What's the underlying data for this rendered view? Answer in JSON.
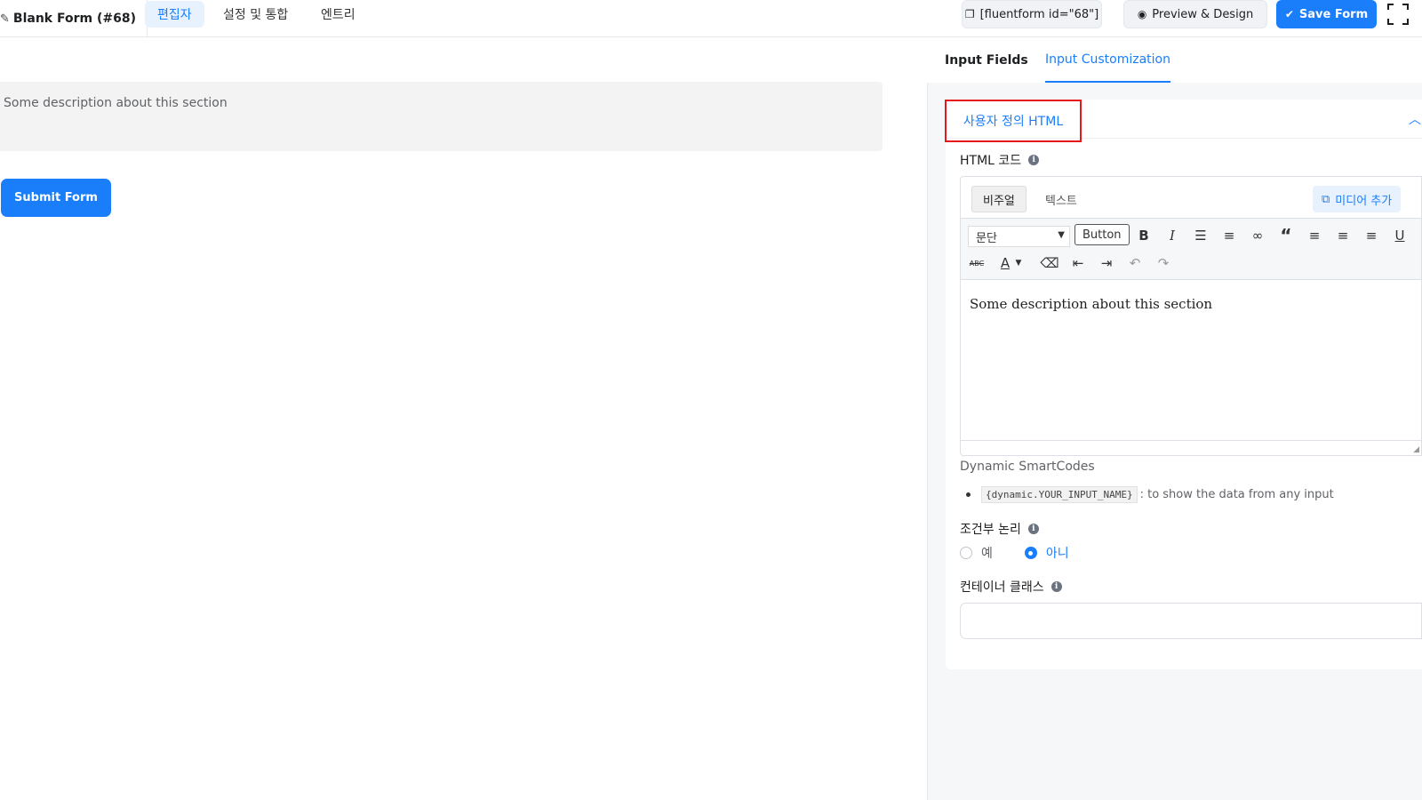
{
  "topbar": {
    "form_title": "Blank Form (#68)",
    "tabs": [
      "편집자",
      "설정 및 통합",
      "엔트리"
    ],
    "shortcode": "[fluentform id=\"68\"]",
    "preview": "Preview & Design",
    "save": "Save Form"
  },
  "canvas": {
    "section_description": "Some description about this section",
    "submit": "Submit Form"
  },
  "panel": {
    "tabs": [
      "Input Fields",
      "Input Customization"
    ],
    "accordion_title": "사용자 정의 HTML",
    "html_code_label": "HTML 코드",
    "editor": {
      "mode_visual": "비주얼",
      "mode_text": "텍스트",
      "add_media": "미디어 추가",
      "format_value": "문단",
      "button_label": "Button",
      "content": "Some description about this section"
    },
    "smartcodes_title": "Dynamic SmartCodes",
    "smartcode_code": "{dynamic.YOUR_INPUT_NAME}",
    "smartcode_desc": ": to show the data from any input",
    "conditional_label": "조건부 논리",
    "radio_yes": "예",
    "radio_no": "아니",
    "container_class_label": "컨테이너 클래스",
    "container_class_value": ""
  },
  "colors": {
    "primary": "#1a7efb",
    "highlight_border": "#e5191c"
  }
}
